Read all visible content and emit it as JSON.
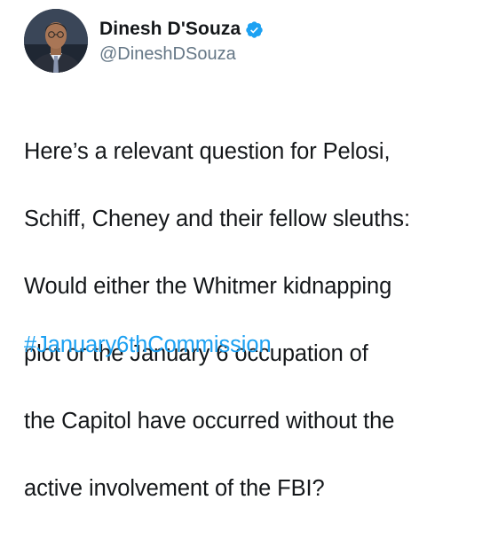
{
  "tweet": {
    "author": {
      "display_name": "Dinesh D'Souza",
      "handle": "@DineshDSouza",
      "verified": true,
      "verified_icon": "verified-badge-icon"
    },
    "text_lines": [
      "Here’s a relevant question for Pelosi,",
      "Schiff, Cheney and their fellow sleuths:",
      "Would either the Whitmer kidnapping",
      "plot or the January 6 occupation of",
      "the Capitol have occurred without the",
      "active involvement of the FBI?"
    ],
    "hashtag": "#January6thCommission"
  },
  "colors": {
    "text": "#14171a",
    "handle": "#657786",
    "link": "#1da1f2",
    "verified": "#1da1f2"
  }
}
